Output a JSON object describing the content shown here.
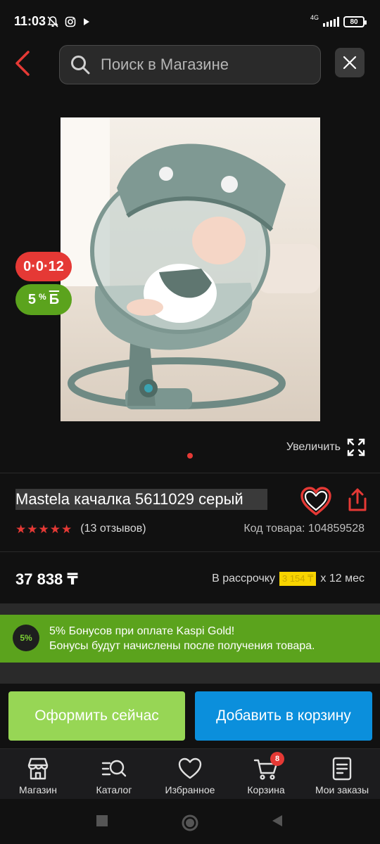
{
  "status_bar": {
    "time": "11:03",
    "network": "4G",
    "battery": "80"
  },
  "header": {
    "search_placeholder": "Поиск в Магазине"
  },
  "product": {
    "badge_installment": "0·0·12",
    "badge_bonus_percent": "5",
    "badge_bonus_sup": "%",
    "badge_bonus_currency": "Б",
    "zoom_label": "Увеличить",
    "title": "Mastela качалка 5611029 серый",
    "rating_stars": 5,
    "reviews": "(13 отзывов)",
    "sku": "Код товара: 104859528",
    "price": "37 838 ₸",
    "installment_prefix": "В рассрочку",
    "installment_amount": "3 154 ₸",
    "installment_suffix": "х 12 мес"
  },
  "bonus_banner": {
    "circle_label": "5%",
    "line1": "5% Бонусов при оплате Kaspi Gold!",
    "line2": "Бонусы будут начислены после получения товара."
  },
  "actions": {
    "buy_now": "Оформить сейчас",
    "add_to_cart": "Добавить в корзину"
  },
  "bottom_nav": {
    "items": [
      {
        "label": "Магазин",
        "icon": "shop-icon"
      },
      {
        "label": "Каталог",
        "icon": "catalog-search-icon"
      },
      {
        "label": "Избранное",
        "icon": "heart-icon"
      },
      {
        "label": "Корзина",
        "icon": "cart-icon",
        "badge": "8"
      },
      {
        "label": "Мои заказы",
        "icon": "orders-icon"
      }
    ]
  },
  "colors": {
    "accent_red": "#e53935",
    "bonus_green": "#5ba31d",
    "buy_now_green": "#97d655",
    "cart_blue": "#0b8fdc",
    "installment_yellow": "#f8d400"
  }
}
